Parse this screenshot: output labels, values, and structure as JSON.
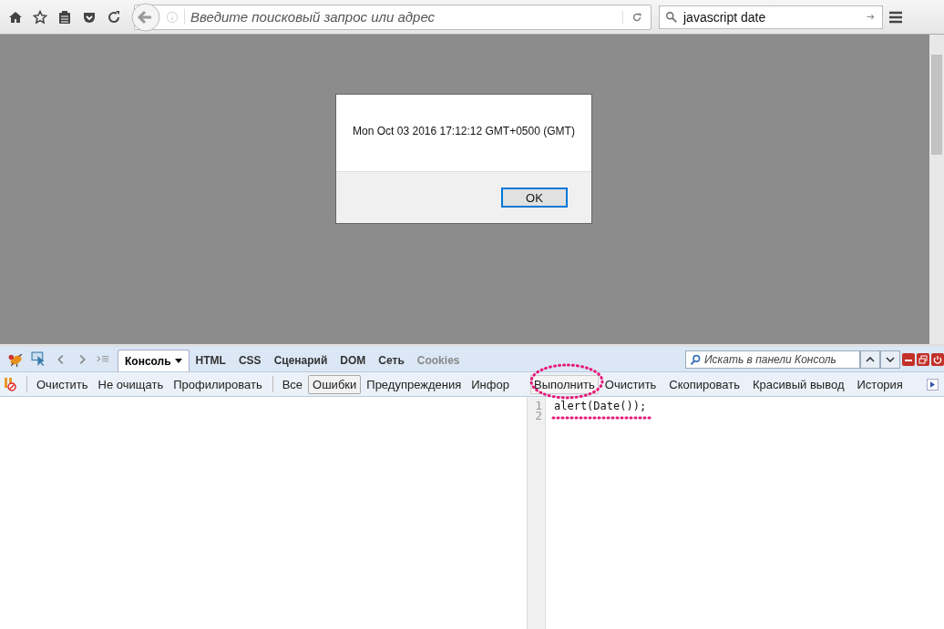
{
  "toolbar": {
    "address_placeholder": "Введите поисковый запрос или адрес",
    "search_value": "javascript date"
  },
  "alert": {
    "message": "Mon Oct 03 2016 17:12:12 GMT+0500 (GMT)",
    "button": "OK"
  },
  "devtools": {
    "tabs": [
      {
        "label": "Консоль",
        "selected": true,
        "disabled": false
      },
      {
        "label": "HTML",
        "selected": false,
        "disabled": false
      },
      {
        "label": "CSS",
        "selected": false,
        "disabled": false
      },
      {
        "label": "Сценарий",
        "selected": false,
        "disabled": false
      },
      {
        "label": "DOM",
        "selected": false,
        "disabled": false
      },
      {
        "label": "Сеть",
        "selected": false,
        "disabled": false
      },
      {
        "label": "Cookies",
        "selected": false,
        "disabled": true
      }
    ],
    "search_placeholder": "Искать в панели Консоль",
    "console_actions": [
      "Очистить",
      "Не очищать",
      "Профилировать"
    ],
    "filters": [
      {
        "label": "Все",
        "selected": false
      },
      {
        "label": "Ошибки",
        "selected": true
      },
      {
        "label": "Предупреждения",
        "selected": false
      },
      {
        "label": "Инфор",
        "selected": false
      }
    ],
    "editor_actions": [
      {
        "label": "Выполнить",
        "kind": "run"
      },
      {
        "label": "Очистить",
        "kind": "plain"
      },
      {
        "label": "Скопировать",
        "kind": "plain"
      },
      {
        "label": "Красивый вывод",
        "kind": "plain"
      },
      {
        "label": "История",
        "kind": "plain"
      }
    ],
    "editor": {
      "lines": [
        {
          "number": "1",
          "code": "alert(Date());"
        },
        {
          "number": "2"
        }
      ]
    }
  }
}
